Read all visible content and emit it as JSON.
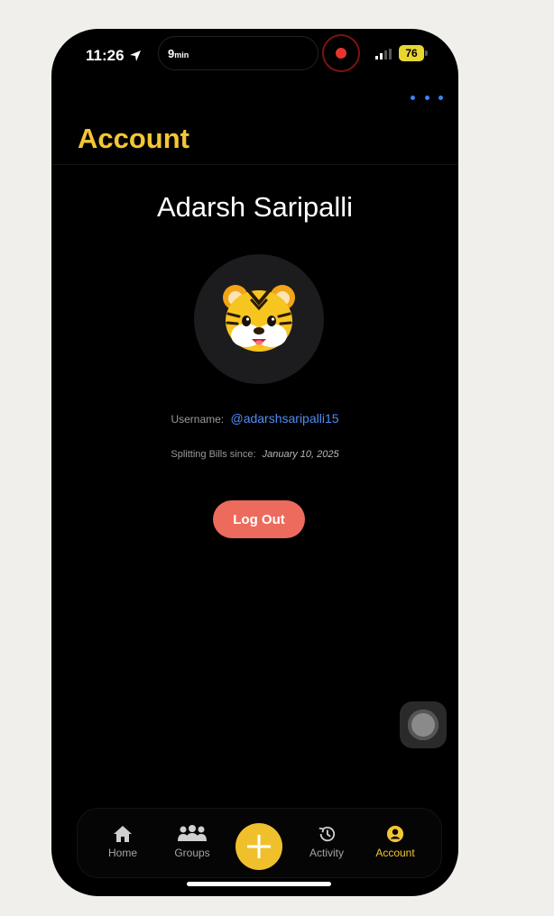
{
  "status_bar": {
    "time": "11:26",
    "timer_value": "9",
    "timer_unit": "min",
    "battery": "76"
  },
  "header": {
    "title": "Account"
  },
  "profile": {
    "full_name": "Adarsh Saripalli",
    "avatar_emoji": "🐯",
    "username_label": "Username:",
    "username_value": "@adarshsaripalli15",
    "since_label": "Splitting Bills since:",
    "since_value": "January 10, 2025",
    "logout_label": "Log Out"
  },
  "tab_bar": {
    "tabs": [
      {
        "label": "Home",
        "icon": "house-icon"
      },
      {
        "label": "Groups",
        "icon": "people-icon"
      },
      {
        "label": "",
        "icon": "plus-icon"
      },
      {
        "label": "Activity",
        "icon": "history-icon"
      },
      {
        "label": "Account",
        "icon": "person-circle-icon"
      }
    ],
    "active": "Account"
  },
  "colors": {
    "accent": "#f3c635",
    "link": "#4f8df7",
    "logout": "#ec6b5d",
    "background": "#000000"
  }
}
